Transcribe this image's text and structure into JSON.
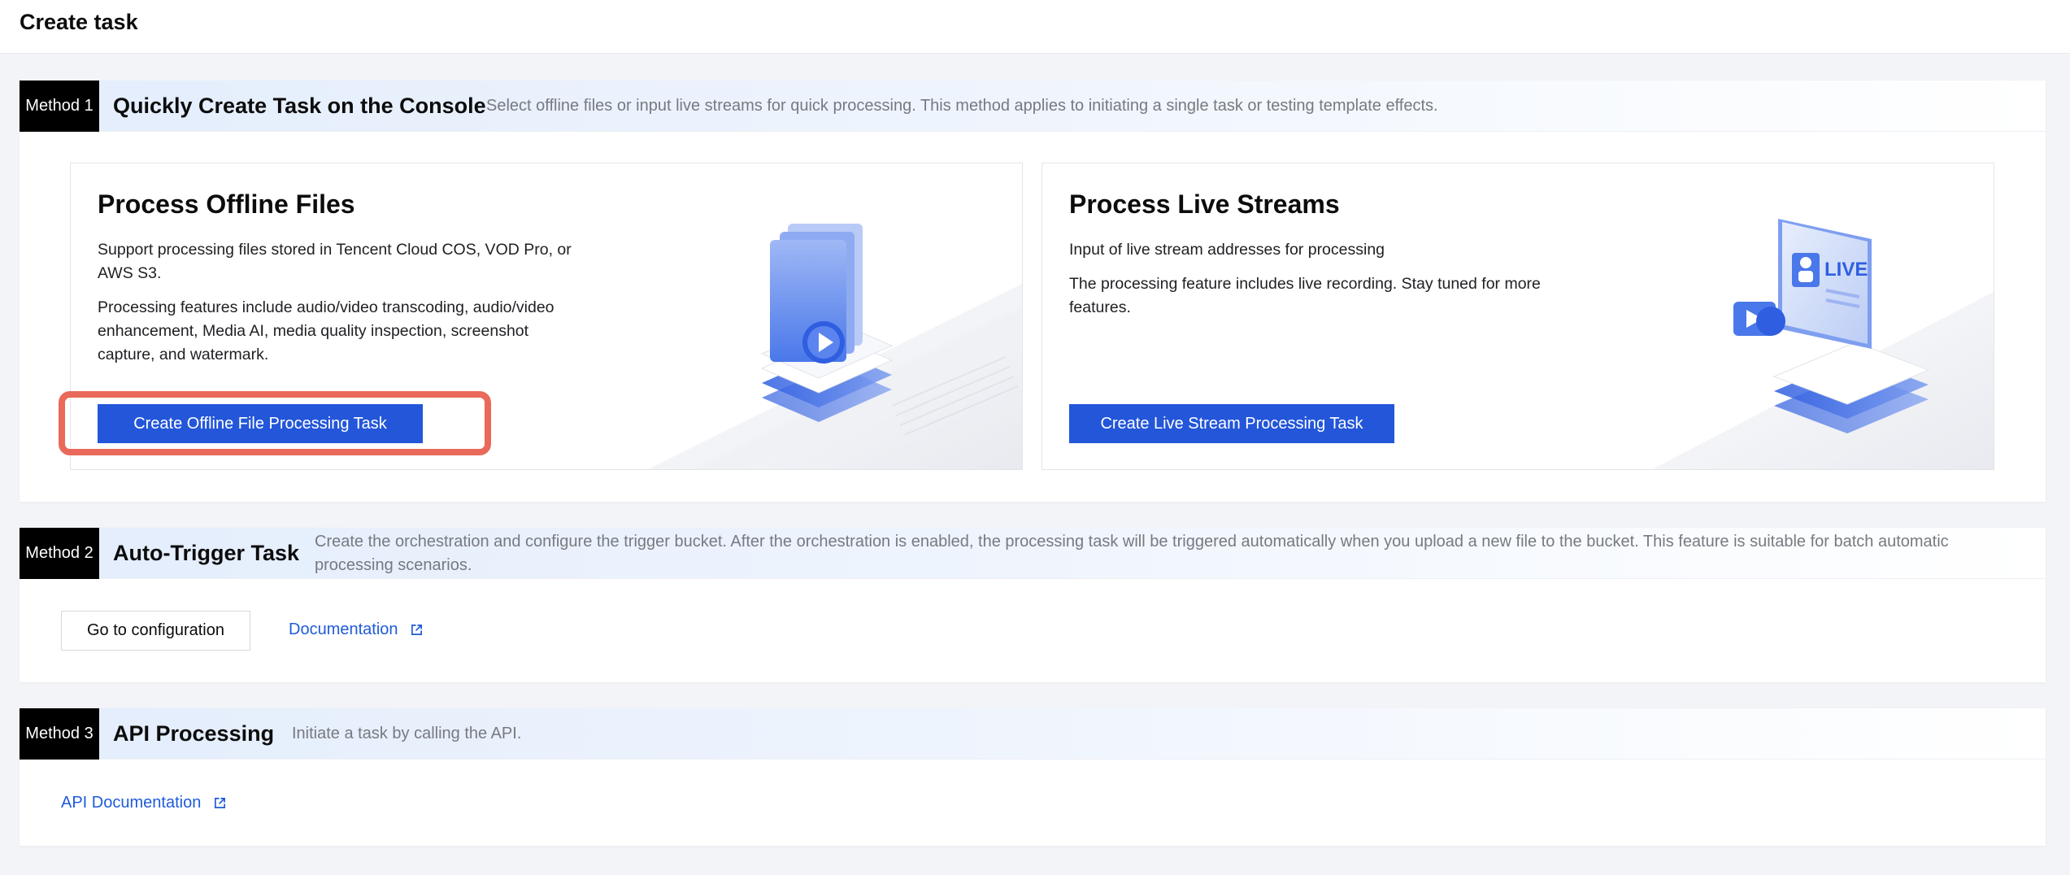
{
  "page": {
    "title": "Create task"
  },
  "method1": {
    "badge": "Method 1",
    "title": "Quickly Create Task on the Console",
    "description": "Select offline files or input live streams for quick processing. This method applies to initiating a single task or testing template effects.",
    "offline": {
      "title": "Process Offline Files",
      "text1": "Support processing files stored in Tencent Cloud COS, VOD Pro, or AWS S3.",
      "text2": "Processing features include audio/video transcoding, audio/video enhancement, Media AI, media quality inspection, screenshot capture, and watermark.",
      "button": "Create Offline File Processing Task"
    },
    "live": {
      "title": "Process Live Streams",
      "text1": "Input of live stream addresses for processing",
      "text2": "The processing feature includes live recording. Stay tuned for more features.",
      "button": "Create Live Stream Processing Task",
      "illustration_text": "LIVE"
    }
  },
  "method2": {
    "badge": "Method 2",
    "title": "Auto-Trigger Task",
    "description": "Create the orchestration and configure the trigger bucket. After the orchestration is enabled, the processing task will be triggered automatically when you upload a new file to the bucket. This feature is suitable for batch automatic processing scenarios.",
    "config_button": "Go to configuration",
    "doc_link": "Documentation"
  },
  "method3": {
    "badge": "Method 3",
    "title": "API Processing",
    "description": "Initiate a task by calling the API.",
    "doc_link": "API Documentation"
  },
  "colors": {
    "primary": "#2356d9",
    "link": "#1f5bd9",
    "highlight": "#e9695a",
    "badge": "#000000"
  }
}
